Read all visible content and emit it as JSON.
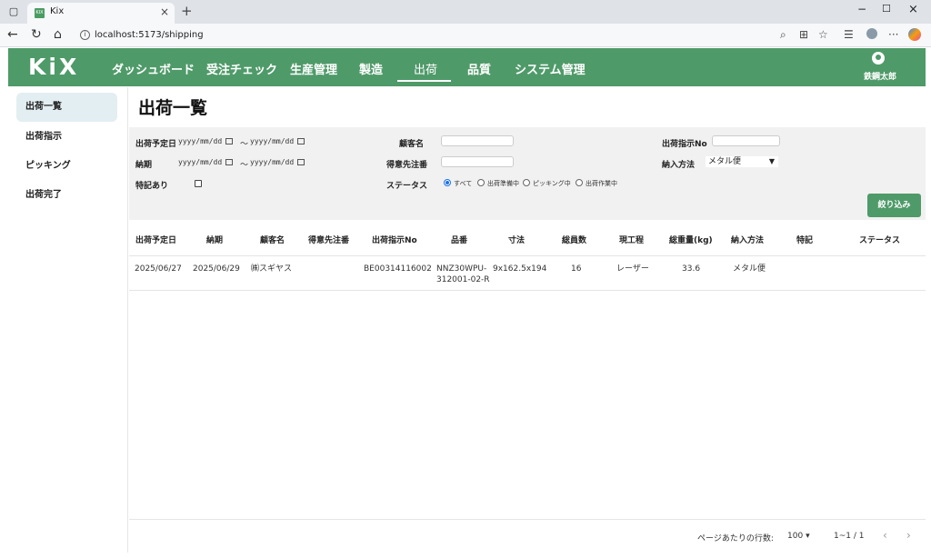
{
  "browser": {
    "tab_title": "Kix",
    "tab_favicon": "KIX",
    "url": "localhost:5173/shipping"
  },
  "app": {
    "logo": "KiX",
    "nav": [
      "ダッシュボード",
      "受注チェック",
      "生産管理",
      "製造",
      "出荷",
      "品質",
      "システム管理"
    ],
    "active_nav": "出荷",
    "user_name": "鉄鋼太郎",
    "brand_color": "#4f9a69"
  },
  "sidebar": {
    "items": [
      {
        "label": "出荷一覧",
        "active": true
      },
      {
        "label": "出荷指示",
        "active": false
      },
      {
        "label": "ピッキング",
        "active": false
      },
      {
        "label": "出荷完了",
        "active": false
      }
    ]
  },
  "page": {
    "title": "出荷一覧"
  },
  "filters": {
    "ship_date_label": "出荷予定日",
    "date_placeholder": "yyyy/mm/dd",
    "range_sep": "～",
    "due_label": "納期",
    "note_label": "特記あり",
    "customer_label": "顧客名",
    "customer_order_label": "得意先注番",
    "status_label": "ステータス",
    "status_options": [
      "すべて",
      "出荷準備中",
      "ピッキング中",
      "出荷作業中"
    ],
    "status_selected": "すべて",
    "instruction_no_label": "出荷指示No",
    "delivery_method_label": "納入方法",
    "delivery_method_value": "メタル便",
    "submit_label": "絞り込み"
  },
  "table": {
    "columns": [
      "出荷予定日",
      "納期",
      "顧客名",
      "得意先注番",
      "出荷指示No",
      "品番",
      "寸法",
      "総員数",
      "現工程",
      "総重量(kg)",
      "納入方法",
      "特記",
      "ステータス"
    ],
    "rows": [
      {
        "ship_date": "2025/06/27",
        "due": "2025/06/29",
        "customer": "㈱スギヤス",
        "customer_order": "",
        "instruction_no": "BE00314116002",
        "part_no_1": "NNZ30WPU-",
        "part_no_2": "312001-02-R",
        "size": "9x162.5x194",
        "qty": "16",
        "process": "レーザー",
        "weight": "33.6",
        "delivery": "メタル便",
        "note": "",
        "status": ""
      }
    ]
  },
  "pagination": {
    "rows_per_page_label": "ページあたりの行数:",
    "rows_per_page": "100",
    "range": "1~1 / 1"
  }
}
